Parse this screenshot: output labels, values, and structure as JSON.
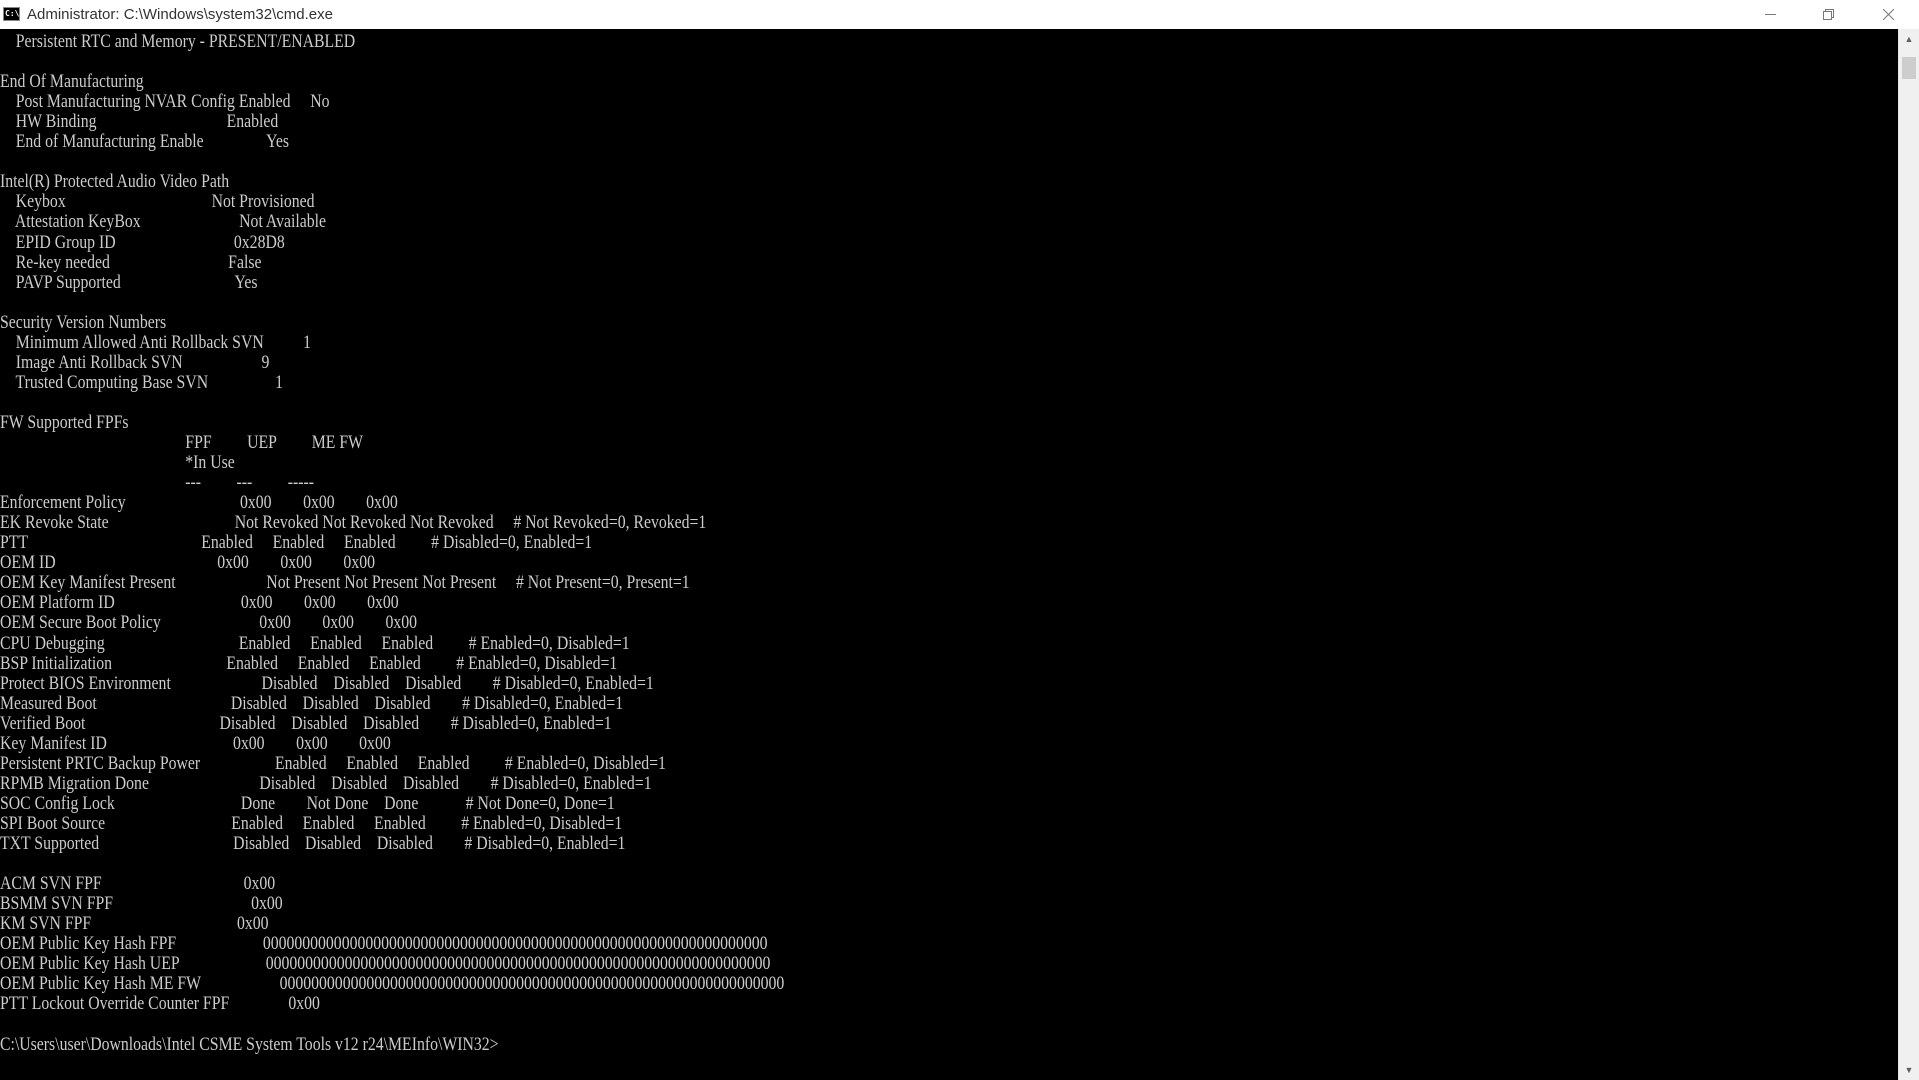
{
  "window": {
    "title": "Administrator: C:\\Windows\\system32\\cmd.exe",
    "icon_text": "C:\\",
    "icons": {
      "app": "cmd-icon",
      "minimize": "minimize-icon",
      "maximize": "restore-icon",
      "close": "close-icon",
      "scroll_up": "scroll-up-arrow-icon",
      "scroll_down": "scroll-down-arrow-icon"
    }
  },
  "console": {
    "foreground": "#cccccc",
    "background": "#000000",
    "lines": [
      "    Persistent RTC and Memory - PRESENT/ENABLED",
      "",
      "End Of Manufacturing",
      "    Post Manufacturing NVAR Config Enabled     No",
      "    HW Binding                                 Enabled",
      "    End of Manufacturing Enable                Yes",
      "",
      "Intel(R) Protected Audio Video Path",
      "    Keybox                                     Not Provisioned",
      "    Attestation KeyBox                         Not Available",
      "    EPID Group ID                              0x28D8",
      "    Re-key needed                              False",
      "    PAVP Supported                             Yes",
      "",
      "Security Version Numbers",
      "    Minimum Allowed Anti Rollback SVN          1",
      "    Image Anti Rollback SVN                    9",
      "    Trusted Computing Base SVN                 1",
      "",
      "FW Supported FPFs",
      "                                               FPF         UEP         ME FW",
      "                                               *In Use",
      "                                               ---         ---         -----",
      "Enforcement Policy                             0x00        0x00        0x00",
      "EK Revoke State                                Not Revoked Not Revoked Not Revoked     # Not Revoked=0, Revoked=1",
      "PTT                                            Enabled     Enabled     Enabled         # Disabled=0, Enabled=1",
      "OEM ID                                         0x00        0x00        0x00",
      "OEM Key Manifest Present                       Not Present Not Present Not Present     # Not Present=0, Present=1",
      "OEM Platform ID                                0x00        0x00        0x00",
      "OEM Secure Boot Policy                         0x00        0x00        0x00",
      "CPU Debugging                                  Enabled     Enabled     Enabled         # Enabled=0, Disabled=1",
      "BSP Initialization                             Enabled     Enabled     Enabled         # Enabled=0, Disabled=1",
      "Protect BIOS Environment                       Disabled    Disabled    Disabled        # Disabled=0, Enabled=1",
      "Measured Boot                                  Disabled    Disabled    Disabled        # Disabled=0, Enabled=1",
      "Verified Boot                                  Disabled    Disabled    Disabled        # Disabled=0, Enabled=1",
      "Key Manifest ID                                0x00        0x00        0x00",
      "Persistent PRTC Backup Power                   Enabled     Enabled     Enabled         # Enabled=0, Disabled=1",
      "RPMB Migration Done                            Disabled    Disabled    Disabled        # Disabled=0, Enabled=1",
      "SOC Config Lock                                Done        Not Done    Done            # Not Done=0, Done=1",
      "SPI Boot Source                                Enabled     Enabled     Enabled         # Enabled=0, Disabled=1",
      "TXT Supported                                  Disabled    Disabled    Disabled        # Disabled=0, Enabled=1",
      "",
      "ACM SVN FPF                                    0x00",
      "BSMM SVN FPF                                   0x00",
      "KM SVN FPF                                     0x00",
      "OEM Public Key Hash FPF                      0000000000000000000000000000000000000000000000000000000000000000",
      "OEM Public Key Hash UEP                      0000000000000000000000000000000000000000000000000000000000000000",
      "OEM Public Key Hash ME FW                    0000000000000000000000000000000000000000000000000000000000000000",
      "PTT Lockout Override Counter FPF               0x00",
      "",
      "C:\\Users\\user\\Downloads\\Intel CSME System Tools v12 r24\\MEInfo\\WIN32>"
    ]
  }
}
